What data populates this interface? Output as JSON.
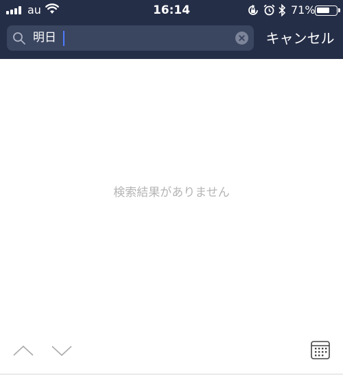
{
  "status_bar": {
    "carrier": "au",
    "time": "16:14",
    "battery_percent": "71%",
    "battery_level": 0.71,
    "icons": [
      "signal-icon",
      "wifi-icon",
      "rotation-lock-icon",
      "alarm-icon",
      "bluetooth-icon",
      "battery-icon"
    ]
  },
  "search": {
    "value": "明日",
    "cancel_label": "キャンセル"
  },
  "results": {
    "empty_message": "検索結果がありません"
  },
  "toolbar": {
    "icons": [
      "chevron-up-icon",
      "chevron-down-icon",
      "calendar-icon"
    ]
  },
  "colors": {
    "header_bg": "#252e47",
    "search_bg": "#3a4560",
    "caret": "#4f7cff",
    "empty_text": "#b5b5b5"
  }
}
